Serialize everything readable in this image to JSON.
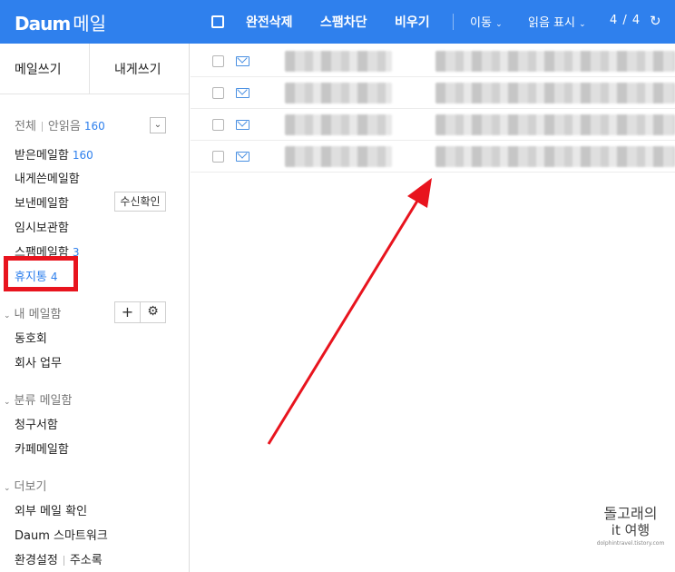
{
  "header": {
    "logo": "Daum",
    "service": "메일",
    "actions": [
      "완전삭제",
      "스팸차단",
      "비우기"
    ],
    "move": "이동",
    "mark_read": "읽음 표시",
    "page_info": "4 / 4"
  },
  "sidebar": {
    "compose": "메일쓰기",
    "self_compose": "내게쓰기",
    "filter_all": "전체",
    "filter_unread": "안읽음",
    "unread_count": "160",
    "folders": [
      {
        "label": "받은메일함",
        "count": "160"
      },
      {
        "label": "내게쓴메일함",
        "count": ""
      },
      {
        "label": "보낸메일함",
        "count": "",
        "button": "수신확인"
      },
      {
        "label": "임시보관함",
        "count": ""
      },
      {
        "label": "스팸메일함",
        "count": "3"
      },
      {
        "label": "휴지통",
        "count": "4"
      }
    ],
    "my_folders_title": "내 메일함",
    "my_folders": [
      "동호회",
      "회사 업무"
    ],
    "categories_title": "분류 메일함",
    "categories": [
      "청구서함",
      "카페메일함"
    ],
    "more_title": "더보기",
    "more": [
      "외부 메일 확인",
      "Daum 스마트워크",
      "환경설정",
      "주소록"
    ]
  },
  "watermark": {
    "line1": "돌고래의",
    "line2": "it 여행",
    "url": "dolphintravel.tistory.com"
  },
  "accent": "#2f80ed",
  "highlight_color": "#e8141e"
}
